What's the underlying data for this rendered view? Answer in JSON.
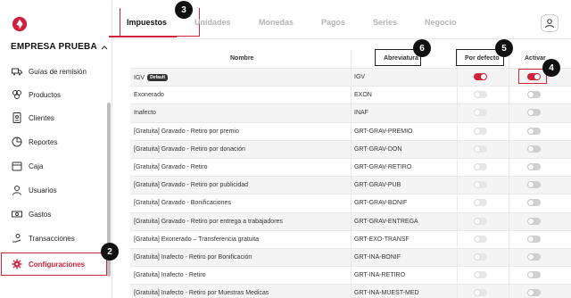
{
  "company": {
    "name": "EMPRESA PRUEBA"
  },
  "sidebar": {
    "items": [
      {
        "label": "Guías de remisión",
        "icon": "truck-icon"
      },
      {
        "label": "Productos",
        "icon": "boxes-icon"
      },
      {
        "label": "Clientes",
        "icon": "id-card-icon"
      },
      {
        "label": "Reportes",
        "icon": "pie-chart-icon"
      },
      {
        "label": "Caja",
        "icon": "cash-register-icon"
      },
      {
        "label": "Usuarios",
        "icon": "user-icon"
      },
      {
        "label": "Gastos",
        "icon": "money-icon"
      },
      {
        "label": "Transacciones",
        "icon": "hand-coin-icon"
      },
      {
        "label": "Configuraciones",
        "icon": "gear-icon"
      }
    ]
  },
  "tabs": [
    "Impuestos",
    "Unidades",
    "Monedas",
    "Pagos",
    "Series",
    "Negocio"
  ],
  "table": {
    "headers": {
      "name": "Nombre",
      "abbr": "Abreviatura",
      "default": "Por defecto",
      "active": "Activar"
    },
    "rows": [
      {
        "name": "IGV",
        "badge": "Default",
        "abbr": "IGV",
        "default": true,
        "active": true
      },
      {
        "name": "Exonerado",
        "abbr": "EXON",
        "default": false,
        "active": false
      },
      {
        "name": "Inafecto",
        "abbr": "INAF",
        "default": false,
        "active": false
      },
      {
        "name": "[Gratuita] Gravado - Retiro por premio",
        "abbr": "GRT-GRAV-PREMIO",
        "default": false,
        "active": false
      },
      {
        "name": "[Gratuita] Gravado - Retiro por donación",
        "abbr": "GRT-GRAV-DON",
        "default": false,
        "active": false
      },
      {
        "name": "[Gratuita] Gravado - Retiro",
        "abbr": "GRT-GRAV-RETIRO",
        "default": false,
        "active": false
      },
      {
        "name": "[Gratuita] Gravado - Retiro por publicidad",
        "abbr": "GRT-GRAV-PUB",
        "default": false,
        "active": false
      },
      {
        "name": "[Gratuita] Gravado - Bonificaciones",
        "abbr": "GRT-GRAV-BONIF",
        "default": false,
        "active": false
      },
      {
        "name": "[Gratuita] Gravado - Retiro por entrega a trabajadores",
        "abbr": "GRT-GRAV-ENTREGA",
        "default": false,
        "active": false
      },
      {
        "name": "[Gratuita] Exonerado – Transferencia gratuita",
        "abbr": "GRT-EXO-TRANSF",
        "default": false,
        "active": false
      },
      {
        "name": "[Gratuita] Inafecto - Retiro por Bonificación",
        "abbr": "GRT-INA-BONIF",
        "default": false,
        "active": false
      },
      {
        "name": "[Gratuita] Inafecto - Retiro",
        "abbr": "GRT-INA-RETIRO",
        "default": false,
        "active": false
      },
      {
        "name": "[Gratuita] Inafecto - Retiro por Muestras Medicas",
        "abbr": "GRT-INA-MUEST-MED",
        "default": false,
        "active": false
      }
    ]
  },
  "callouts": [
    "2",
    "3",
    "4",
    "5",
    "6"
  ],
  "colors": {
    "accent": "#d0223a",
    "text": "#222222",
    "muted": "#b4b4b4"
  }
}
